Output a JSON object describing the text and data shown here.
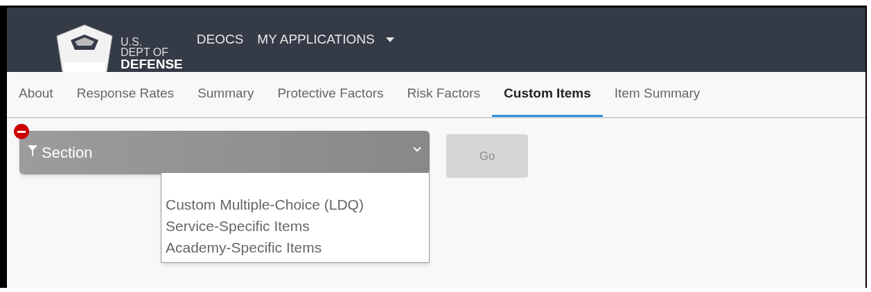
{
  "header": {
    "logo_lines": [
      "U.S.",
      "DEPT OF",
      "DEFENSE"
    ],
    "nav": [
      {
        "label": "DEOCS",
        "kind": "link"
      },
      {
        "label": "MY APPLICATIONS",
        "kind": "dropdown"
      }
    ]
  },
  "tabs": [
    {
      "label": "About",
      "selected": false
    },
    {
      "label": "Response Rates",
      "selected": false
    },
    {
      "label": "Summary",
      "selected": false
    },
    {
      "label": "Protective Factors",
      "selected": false
    },
    {
      "label": "Risk Factors",
      "selected": false
    },
    {
      "label": "Custom Items",
      "selected": true
    },
    {
      "label": "Item Summary",
      "selected": false
    }
  ],
  "filter": {
    "label": "Section",
    "expanded": true,
    "options": [
      "Custom Multiple-Choice (LDQ)",
      "Service-Specific Items",
      "Academy-Specific Items"
    ]
  },
  "go_button": {
    "label": "Go",
    "disabled": true
  }
}
